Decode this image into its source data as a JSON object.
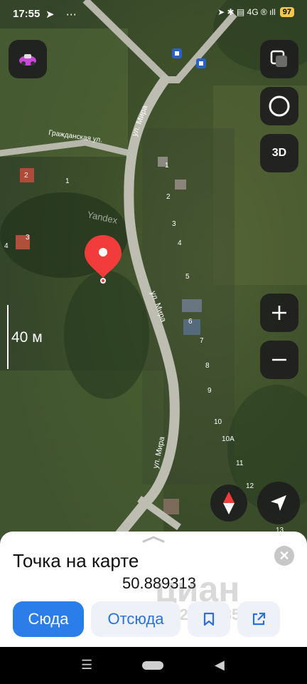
{
  "status_bar": {
    "time": "17:55",
    "left_icons": "➤ ⋯",
    "right_icons": "➤ ✱ ▤ 4G ® ıll",
    "battery": "97"
  },
  "map": {
    "streets": {
      "mira_top": "ул. Мира",
      "mira_middle": "ул. Мира",
      "mira_bottom": "ул. Мира",
      "grazhdanskaya": "Гражданская ул."
    },
    "watermark": "Yandex",
    "scale": "40 м",
    "house_numbers": [
      "2",
      "1",
      "3",
      "4",
      "1",
      "2",
      "3",
      "4",
      "5",
      "6",
      "7",
      "8",
      "9",
      "10",
      "10А",
      "11",
      "12",
      "13"
    ],
    "three_d_label": "3D"
  },
  "card": {
    "title": "Точка на карте",
    "coordinates": "50.889313",
    "watermark": "циан",
    "watermark_id": "ID 312014585"
  },
  "buttons": {
    "here": "Сюда",
    "from": "Отсюда"
  },
  "icons": {
    "layers": "layers-icon",
    "traffic": "traffic-ring-icon",
    "zoom_in": "plus-icon",
    "zoom_out": "minus-icon",
    "compass": "compass-icon",
    "location": "navigation-arrow-icon",
    "bookmark": "bookmark-icon",
    "share": "share-icon",
    "close": "close-icon"
  },
  "colors": {
    "accent": "#2b7de9",
    "pin": "#f23b3b",
    "card_bg": "#ffffff"
  }
}
